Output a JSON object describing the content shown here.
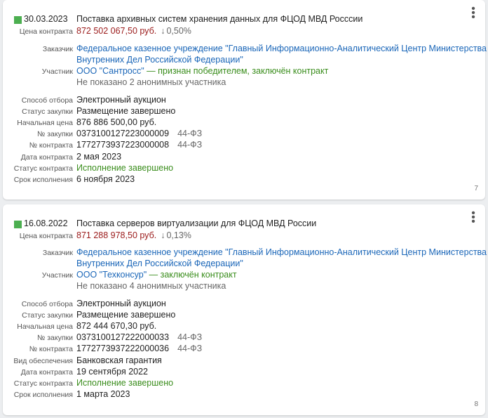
{
  "cards": [
    {
      "date": "30.03.2023",
      "title": "Поставка архивных систем хранения данных для ФЦОД МВД Росссии",
      "price_label": "Цена контракта",
      "price": "872 502 067,50 руб.",
      "price_change": "0,50%",
      "customer_label": "Заказчик",
      "customer_line1": "Федеральное казенное учреждение \"Главный Информационно-Аналитический Центр Министерства",
      "customer_line2": "Внутренних Дел Российской Федерации\"",
      "participant_label": "Участник",
      "participant": "ООО \"Сантросс\"",
      "participant_status": " — признан победителем, заключён контракт",
      "anonymous": "Не показано 2 анонимных участника",
      "method_label": "Способ отбора",
      "method": "Электронный аукцион",
      "proc_status_label": "Статус закупки",
      "proc_status": "Размещение завершено",
      "start_price_label": "Начальная цена",
      "start_price": "876 886 500,00 руб.",
      "proc_no_label": "№ закупки",
      "proc_no": "0373100127223000009",
      "proc_law": "44-ФЗ",
      "contract_no_label": "№ контракта",
      "contract_no": "1772773937223000008",
      "contract_law": "44-ФЗ",
      "contract_date_label": "Дата контракта",
      "contract_date": "2 мая 2023",
      "contract_status_label": "Статус контракта",
      "contract_status": "Исполнение завершено",
      "deadline_label": "Срок исполнения",
      "deadline": "6 ноября 2023",
      "page": "7"
    },
    {
      "date": "16.08.2022",
      "title": "Поставка серверов виртуализации для ФЦОД МВД России",
      "price_label": "Цена контракта",
      "price": "871 288 978,50 руб.",
      "price_change": "0,13%",
      "customer_label": "Заказчик",
      "customer_line1": "Федеральное казенное учреждение \"Главный Информационно-Аналитический Центр Министерства",
      "customer_line2": "Внутренних Дел Российской Федерации\"",
      "participant_label": "Участник",
      "participant": "ООО \"Техконсур\"",
      "participant_status": " — заключён контракт",
      "anonymous": "Не показано 4 анонимных участника",
      "method_label": "Способ отбора",
      "method": "Электронный аукцион",
      "proc_status_label": "Статус закупки",
      "proc_status": "Размещение завершено",
      "start_price_label": "Начальная цена",
      "start_price": "872 444 670,30 руб.",
      "proc_no_label": "№ закупки",
      "proc_no": "0373100127222000033",
      "proc_law": "44-ФЗ",
      "contract_no_label": "№ контракта",
      "contract_no": "1772773937222000036",
      "contract_law": "44-ФЗ",
      "security_label": "Вид обеспечения",
      "security": "Банковская гарантия",
      "contract_date_label": "Дата контракта",
      "contract_date": "19 сентября 2022",
      "contract_status_label": "Статус контракта",
      "contract_status": "Исполнение завершено",
      "deadline_label": "Срок исполнения",
      "deadline": "1 марта 2023",
      "page": "8"
    }
  ],
  "icons": {
    "menu": "more-vertical-icon",
    "arrow": "arrow-down-icon"
  },
  "colors": {
    "status_square": "#4caf50",
    "price": "#9b1b1b",
    "link": "#1a66b8",
    "success": "#3a8d1c"
  }
}
